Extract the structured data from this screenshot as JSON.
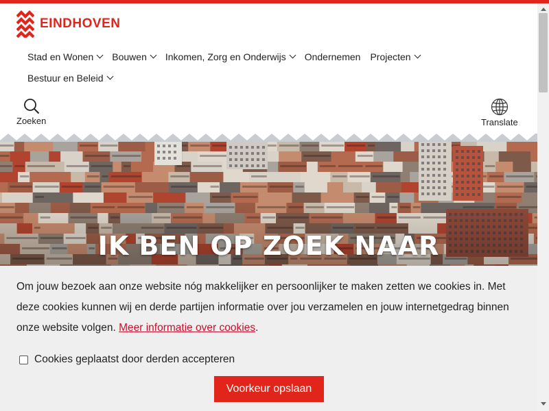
{
  "brand": {
    "name": "EINDHOVEN",
    "color": "#e1251b"
  },
  "nav": {
    "row1": [
      {
        "label": "Stad en Wonen",
        "has_dropdown": true
      },
      {
        "label": "Bouwen",
        "has_dropdown": true
      },
      {
        "label": "Inkomen, Zorg en Onderwijs",
        "has_dropdown": true
      },
      {
        "label": "Ondernemen",
        "has_dropdown": false
      },
      {
        "label": "Projecten",
        "has_dropdown": true
      }
    ],
    "row2": [
      {
        "label": "Bestuur en Beleid",
        "has_dropdown": true
      }
    ]
  },
  "tools": {
    "search_label": "Zoeken",
    "search_icon": "search-icon",
    "translate_label": "Translate",
    "translate_icon": "globe-icon"
  },
  "hero": {
    "title": "IK BEN OP ZOEK NAAR"
  },
  "cookie": {
    "text": "Om jouw bezoek aan onze website nóg makkelijker en persoonlijker te maken zetten we cookies in. Met deze cookies kunnen wij en derde partijen informatie over jou verzamelen en jouw internetgedrag binnen onze website volgen. ",
    "link_text": "Meer informatie over cookies",
    "after_link": ".",
    "checkbox_label": "Cookies geplaatst door derden accepteren",
    "checkbox_checked": false,
    "button_label": "Voorkeur opslaan"
  }
}
